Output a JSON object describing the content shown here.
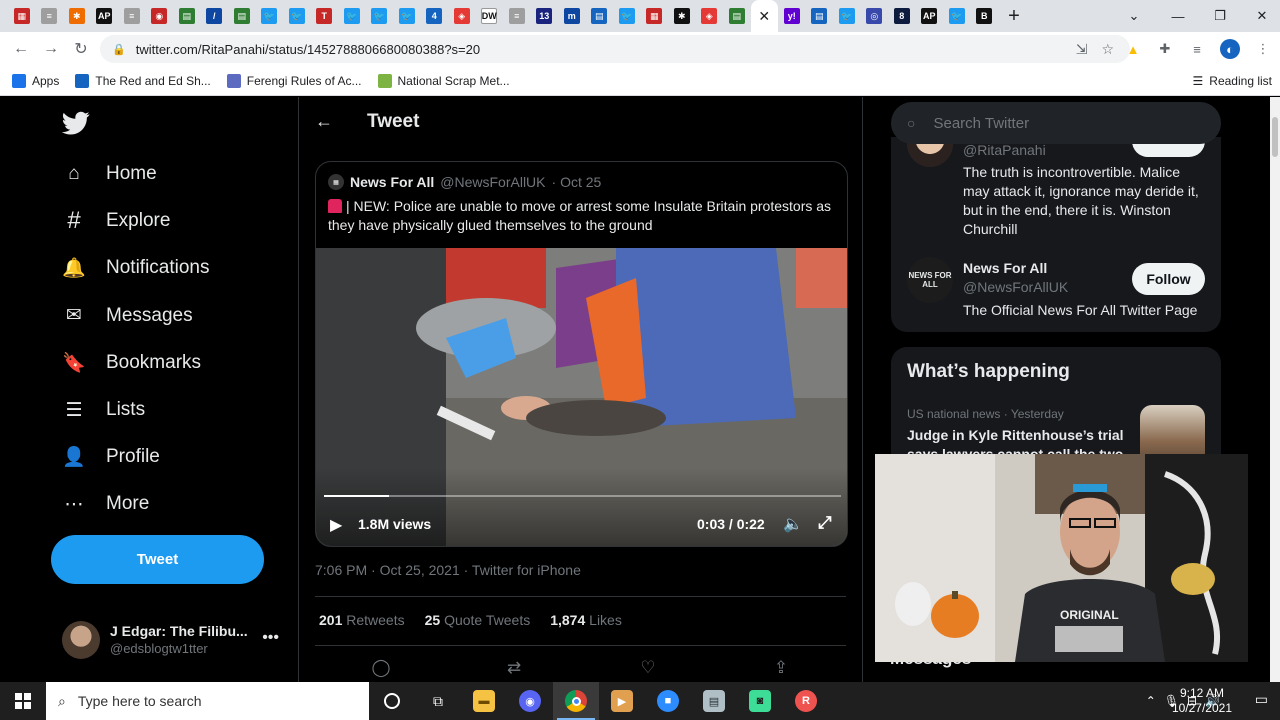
{
  "browser": {
    "tabs": [
      {
        "icon": "flag-icon",
        "color": "#c62828",
        "glyph": "▦"
      },
      {
        "icon": "news-icon",
        "color": "#9e9e9e",
        "glyph": "≡"
      },
      {
        "icon": "nbc-icon",
        "color": "#ef6c00",
        "glyph": "✱"
      },
      {
        "icon": "ap-icon",
        "color": "#111111",
        "glyph": "AP"
      },
      {
        "icon": "news-icon",
        "color": "#9e9e9e",
        "glyph": "≡"
      },
      {
        "icon": "daily-icon",
        "color": "#c62828",
        "glyph": "◉"
      },
      {
        "icon": "scrap-icon",
        "color": "#2e7d32",
        "glyph": "▤"
      },
      {
        "icon": "slash-icon",
        "color": "#0d47a1",
        "glyph": "/"
      },
      {
        "icon": "scrap-icon",
        "color": "#2e7d32",
        "glyph": "▤"
      },
      {
        "icon": "twitter-icon",
        "color": "#1d9bf0",
        "glyph": "🐦"
      },
      {
        "icon": "twitter-icon",
        "color": "#1d9bf0",
        "glyph": "🐦"
      },
      {
        "icon": "times-icon",
        "color": "#c62828",
        "glyph": "T"
      },
      {
        "icon": "twitter-icon",
        "color": "#1d9bf0",
        "glyph": "🐦"
      },
      {
        "icon": "twitter-icon",
        "color": "#1d9bf0",
        "glyph": "🐦"
      },
      {
        "icon": "twitter-icon",
        "color": "#1d9bf0",
        "glyph": "🐦"
      },
      {
        "icon": "news-icon",
        "color": "#1565c0",
        "glyph": "4"
      },
      {
        "icon": "red-icon",
        "color": "#e53935",
        "glyph": "◈"
      },
      {
        "icon": "dw-icon",
        "color": "#ffffff",
        "glyph": "DW"
      },
      {
        "icon": "news-icon",
        "color": "#9e9e9e",
        "glyph": "≡"
      },
      {
        "icon": "num-icon",
        "color": "#1a237e",
        "glyph": "13"
      },
      {
        "icon": "m-icon",
        "color": "#0d47a1",
        "glyph": "m"
      },
      {
        "icon": "doc-icon",
        "color": "#1565c0",
        "glyph": "▤"
      },
      {
        "icon": "twitter-icon",
        "color": "#1d9bf0",
        "glyph": "🐦"
      },
      {
        "icon": "flag-icon",
        "color": "#c62828",
        "glyph": "▦"
      },
      {
        "icon": "black-icon",
        "color": "#111111",
        "glyph": "✱"
      },
      {
        "icon": "red-icon",
        "color": "#e53935",
        "glyph": "◈"
      },
      {
        "icon": "scrap-icon",
        "color": "#2e7d32",
        "glyph": "▤"
      },
      {
        "icon": "close-icon",
        "color": "#ffffff",
        "glyph": "✕",
        "active": true
      },
      {
        "icon": "yahoo-icon",
        "color": "#6001d2",
        "glyph": "y!"
      },
      {
        "icon": "doc-icon",
        "color": "#1565c0",
        "glyph": "▤"
      },
      {
        "icon": "twitter-icon",
        "color": "#1d9bf0",
        "glyph": "🐦"
      },
      {
        "icon": "eye-icon",
        "color": "#3949ab",
        "glyph": "◎"
      },
      {
        "icon": "num-icon",
        "color": "#0d1b3e",
        "glyph": "8"
      },
      {
        "icon": "ap-icon",
        "color": "#111111",
        "glyph": "AP"
      },
      {
        "icon": "twitter-icon",
        "color": "#1d9bf0",
        "glyph": "🐦"
      },
      {
        "icon": "b-icon",
        "color": "#111111",
        "glyph": "B"
      }
    ],
    "url": "twitter.com/RitaPanahi/status/1452788806680080388?s=20",
    "bookmarks": [
      {
        "label": "Apps",
        "icon": "apps-grid-icon",
        "color": "#1a73e8"
      },
      {
        "label": "The Red and Ed Sh...",
        "icon": "blogger-icon",
        "color": "#1565c0"
      },
      {
        "label": "Ferengi Rules of Ac...",
        "icon": "ferengi-icon",
        "color": "#5c6bc0"
      },
      {
        "label": "National Scrap Met...",
        "icon": "scrap-icon",
        "color": "#7cb342"
      }
    ],
    "reading_list": "Reading list"
  },
  "twitter": {
    "nav": [
      {
        "label": "Home",
        "icon": "home-icon"
      },
      {
        "label": "Explore",
        "icon": "hashtag-icon"
      },
      {
        "label": "Notifications",
        "icon": "bell-icon"
      },
      {
        "label": "Messages",
        "icon": "envelope-icon"
      },
      {
        "label": "Bookmarks",
        "icon": "bookmark-icon"
      },
      {
        "label": "Lists",
        "icon": "list-icon"
      },
      {
        "label": "Profile",
        "icon": "person-icon"
      },
      {
        "label": "More",
        "icon": "more-circle-icon"
      }
    ],
    "tweet_button": "Tweet",
    "account": {
      "name": "J Edgar: The Filibu...",
      "handle": "@edsblogtw1tter"
    },
    "header_title": "Tweet",
    "quoted": {
      "name": "News For All",
      "handle": "@NewsForAllUK",
      "date": "· Oct 25",
      "text": "| NEW: Police are unable to move or arrest some Insulate Britain protestors as they have physically glued themselves to the ground",
      "views": "1.8M views",
      "time": "0:03 / 0:22",
      "progress": 0.125
    },
    "meta": "7:06 PM · Oct 25, 2021 · Twitter for iPhone",
    "stats": [
      {
        "count": "201",
        "label": "Retweets"
      },
      {
        "count": "25",
        "label": "Quote Tweets"
      },
      {
        "count": "1,874",
        "label": "Likes"
      }
    ],
    "search_placeholder": "Search Twitter",
    "who": {
      "rita_handle": "@RitaPanahi",
      "rita_bio": "The truth is incontrovertible. Malice may attack it, ignorance may deride it, but in the end, there it is. Winston Churchill",
      "nfa_name": "News For All",
      "nfa_handle": "@NewsForAllUK",
      "nfa_bio": "The Official News For All Twitter Page",
      "follow": "Follow",
      "nfa_logo": "NEWS FOR ALL"
    },
    "happening": {
      "title": "What’s happening",
      "meta": "US national news · Yesterday",
      "text": "Judge in Kyle Rittenhouse’s trial says lawyers cannot call the two"
    },
    "messages": "Messages"
  },
  "taskbar": {
    "search_placeholder": "Type here to search",
    "time": "9:12 AM",
    "date": "10/27/2021"
  }
}
